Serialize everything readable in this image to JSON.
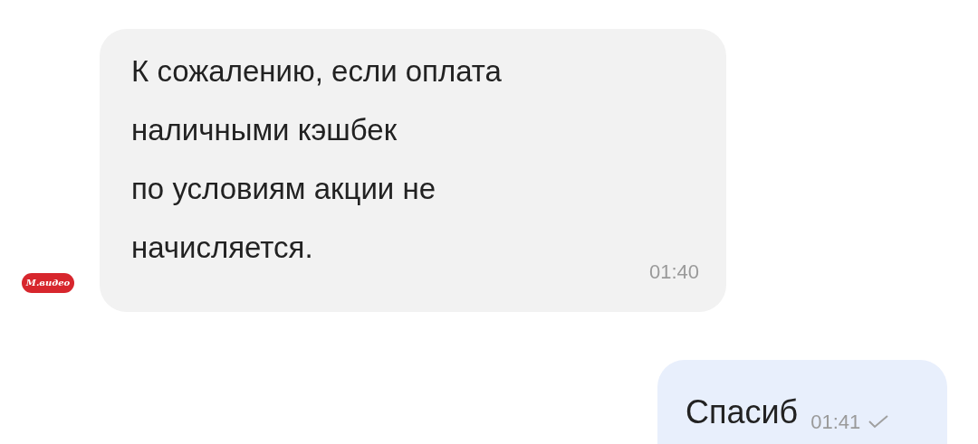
{
  "messages": [
    {
      "kind": "incoming",
      "sender_logo": "М.видео",
      "text": "К сожалению, если оплата\nналичными кэшбек\nпо условиям акции не\nначисляется.",
      "time": "01:40"
    },
    {
      "kind": "outgoing",
      "text": "Спасиб",
      "time": "01:41",
      "read": false
    }
  ]
}
